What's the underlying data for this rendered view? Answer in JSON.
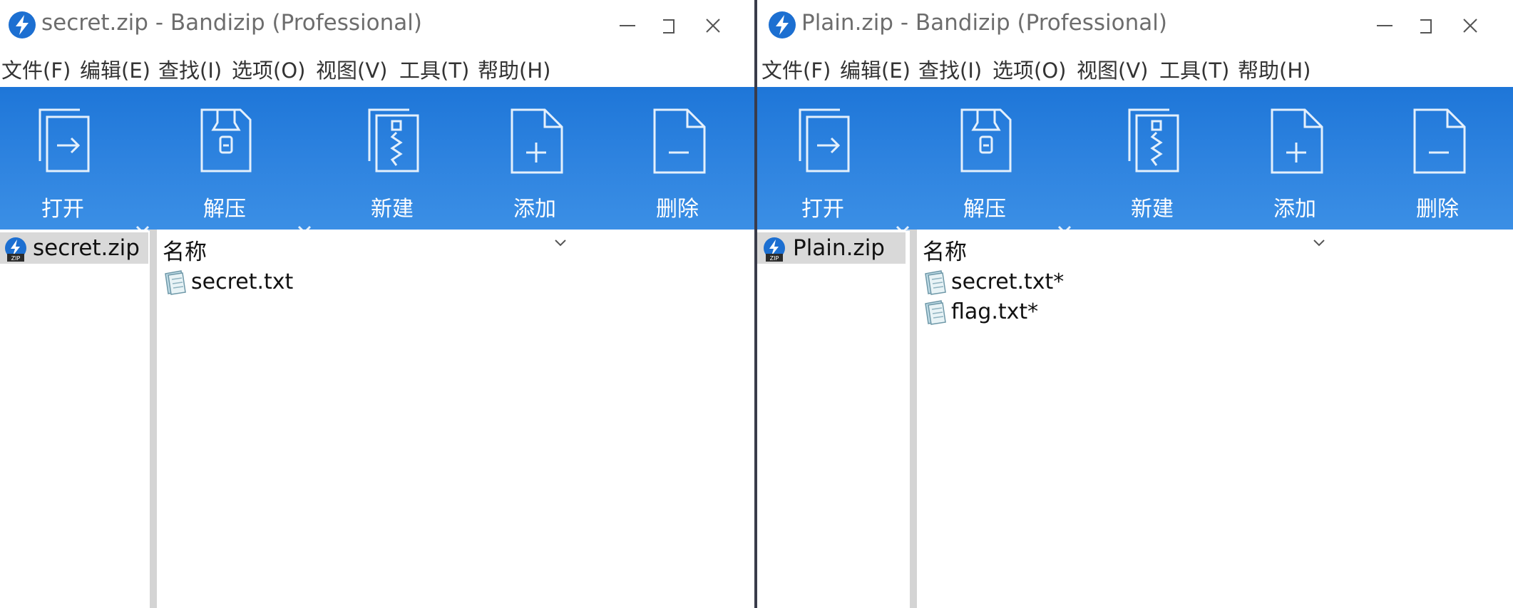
{
  "colors": {
    "ribbon": "#2b7fdd",
    "selection": "#d9d9d9",
    "app_icon": "#1c6fd1"
  },
  "windows": [
    {
      "title": "secret.zip - Bandizip (Professional)",
      "menu": [
        "文件(F)",
        "编辑(E)",
        "查找(I)",
        "选项(O)",
        "视图(V)",
        "工具(T)",
        "帮助(H)"
      ],
      "toolbar": [
        {
          "label": "打开",
          "icon": "open-icon"
        },
        {
          "label": "解压",
          "icon": "extract-icon"
        },
        {
          "label": "新建",
          "icon": "new-archive-icon"
        },
        {
          "label": "添加",
          "icon": "add-file-icon"
        },
        {
          "label": "删除",
          "icon": "delete-file-icon"
        }
      ],
      "tree": {
        "selected": "secret.zip"
      },
      "list": {
        "column": "名称",
        "files": [
          "secret.txt"
        ]
      }
    },
    {
      "title": "Plain.zip - Bandizip (Professional)",
      "menu": [
        "文件(F)",
        "编辑(E)",
        "查找(I)",
        "选项(O)",
        "视图(V)",
        "工具(T)",
        "帮助(H)"
      ],
      "toolbar": [
        {
          "label": "打开",
          "icon": "open-icon"
        },
        {
          "label": "解压",
          "icon": "extract-icon"
        },
        {
          "label": "新建",
          "icon": "new-archive-icon"
        },
        {
          "label": "添加",
          "icon": "add-file-icon"
        },
        {
          "label": "删除",
          "icon": "delete-file-icon"
        }
      ],
      "tree": {
        "selected": "Plain.zip"
      },
      "list": {
        "column": "名称",
        "files": [
          "secret.txt*",
          "flag.txt*"
        ]
      }
    }
  ]
}
